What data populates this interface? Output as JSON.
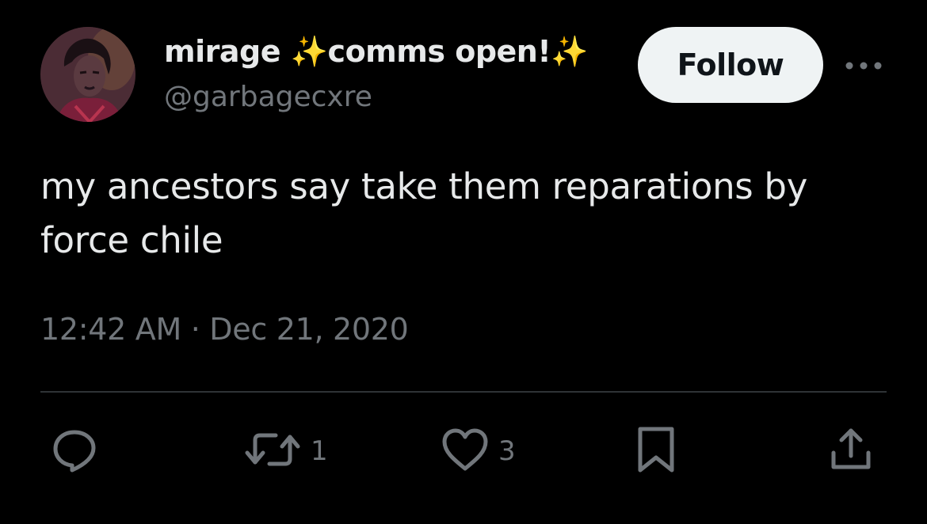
{
  "author": {
    "display_name": "mirage",
    "display_suffix": "comms open!",
    "handle": "@garbagecxre"
  },
  "follow_button": {
    "label": "Follow"
  },
  "tweet": {
    "text": "my ancestors say take them reparations by force chile",
    "timestamp": "12:42 AM · Dec 21, 2020"
  },
  "actions": {
    "retweets": "1",
    "likes": "3"
  },
  "icons": {
    "more": "more-horizontal-icon",
    "reply": "reply-bubble-icon",
    "retweet": "retweet-icon",
    "like": "heart-icon",
    "bookmark": "bookmark-icon",
    "share": "share-upload-icon",
    "sparkle": "sparkles-icon"
  },
  "colors": {
    "background": "#000000",
    "text_primary": "#e7e9ea",
    "text_secondary": "#71767b",
    "divider": "#2f3336",
    "follow_bg": "#eff3f4",
    "sparkle": "#ffc83d"
  }
}
